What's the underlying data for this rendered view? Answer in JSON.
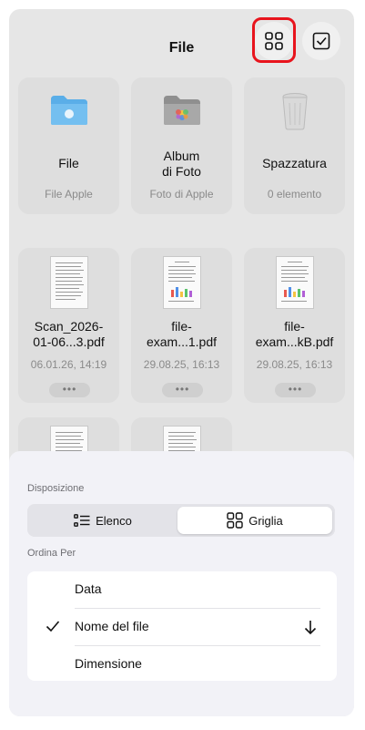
{
  "header": {
    "title": "File"
  },
  "tiles": [
    {
      "name": "File",
      "subtitle": "File Apple"
    },
    {
      "name": "Album\ndi Foto",
      "subtitle": "Foto di Apple"
    },
    {
      "name": "Spazzatura",
      "subtitle": "0 elemento"
    },
    {
      "name": "Scan_2026-\n01-06...3.pdf",
      "subtitle": "06.01.26, 14:19"
    },
    {
      "name": "file-\nexam...1.pdf",
      "subtitle": "29.08.25, 16:13"
    },
    {
      "name": "file-\nexam...kB.pdf",
      "subtitle": "29.08.25, 16:13"
    }
  ],
  "more_label": "•••",
  "sheet": {
    "layout_label": "Disposizione",
    "list_option": "Elenco",
    "grid_option": "Griglia",
    "selected_layout": "Griglia",
    "sort_label": "Ordina Per",
    "sort_options": [
      "Data",
      "Nome del file",
      "Dimensione"
    ],
    "selected_sort": "Nome del file",
    "sort_direction": "descending"
  },
  "colors": {
    "highlight": "#e8141d",
    "folder_blue": "#5aaee8"
  }
}
